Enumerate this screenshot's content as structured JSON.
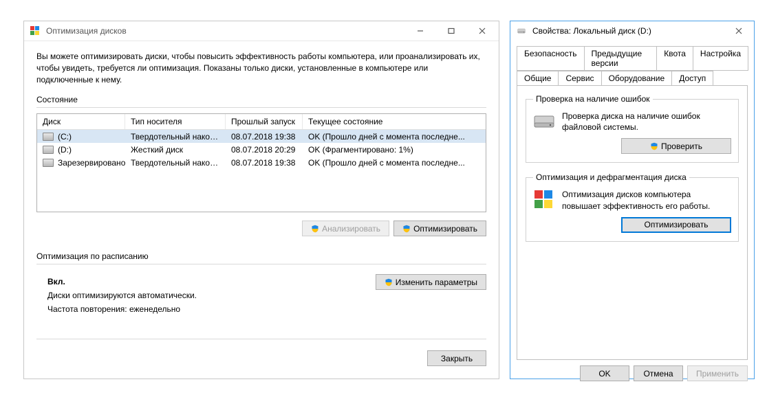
{
  "optimize": {
    "title": "Оптимизация дисков",
    "intro": "Вы можете оптимизировать диски, чтобы повысить эффективность работы  компьютера, или проанализировать их, чтобы увидеть, требуется ли оптимизация. Показаны только диски, установленные в компьютере или подключенные к нему.",
    "state_label": "Состояние",
    "columns": {
      "drive": "Диск",
      "media": "Тип носителя",
      "last_run": "Прошлый запуск",
      "status": "Текущее состояние"
    },
    "rows": [
      {
        "drive": "(C:)",
        "media": "Твердотельный накоп...",
        "last_run": "08.07.2018 19:38",
        "status": "OK (Прошло дней с момента последне...",
        "selected": true
      },
      {
        "drive": "(D:)",
        "media": "Жесткий диск",
        "last_run": "08.07.2018 20:29",
        "status": "OK (Фрагментировано: 1%)",
        "selected": false
      },
      {
        "drive": "Зарезервировано ...",
        "media": "Твердотельный накоп...",
        "last_run": "08.07.2018 19:38",
        "status": "OK (Прошло дней с момента последне...",
        "selected": false
      }
    ],
    "buttons": {
      "analyze": "Анализировать",
      "optimize": "Оптимизировать",
      "change": "Изменить параметры",
      "close": "Закрыть"
    },
    "schedule": {
      "label": "Оптимизация по расписанию",
      "on": "Вкл.",
      "auto": "Диски оптимизируются автоматически.",
      "freq": "Частота повторения: еженедельно"
    }
  },
  "props": {
    "title": "Свойства: Локальный диск (D:)",
    "tabs_row1": [
      "Безопасность",
      "Предыдущие версии",
      "Квота",
      "Настройка"
    ],
    "tabs_row2": [
      "Общие",
      "Сервис",
      "Оборудование",
      "Доступ"
    ],
    "active_tab": "Сервис",
    "group1": {
      "legend": "Проверка на наличие ошибок",
      "text": "Проверка диска на наличие ошибок файловой системы.",
      "button": "Проверить"
    },
    "group2": {
      "legend": "Оптимизация и дефрагментация диска",
      "text": "Оптимизация дисков компьютера повышает эффективность его работы.",
      "button": "Оптимизировать"
    },
    "footer": {
      "ok": "OK",
      "cancel": "Отмена",
      "apply": "Применить"
    }
  }
}
